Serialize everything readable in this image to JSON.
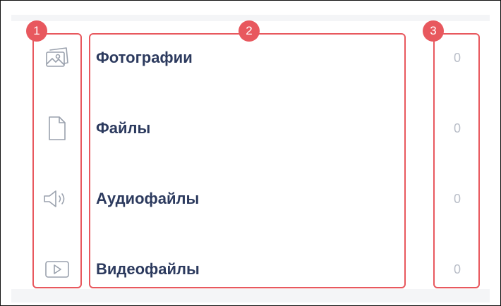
{
  "markers": [
    "1",
    "2",
    "3"
  ],
  "items": [
    {
      "icon": "photo-icon",
      "label": "Фотографии",
      "count": "0"
    },
    {
      "icon": "file-icon",
      "label": "Файлы",
      "count": "0"
    },
    {
      "icon": "speaker-icon",
      "label": "Аудиофайлы",
      "count": "0"
    },
    {
      "icon": "video-play-icon",
      "label": "Видеофайлы",
      "count": "0"
    }
  ],
  "colors": {
    "annotation": "#e8585e",
    "label_text": "#2c3a5e",
    "count_text": "#b9bec8",
    "icon_stroke": "#9aa1ad"
  }
}
